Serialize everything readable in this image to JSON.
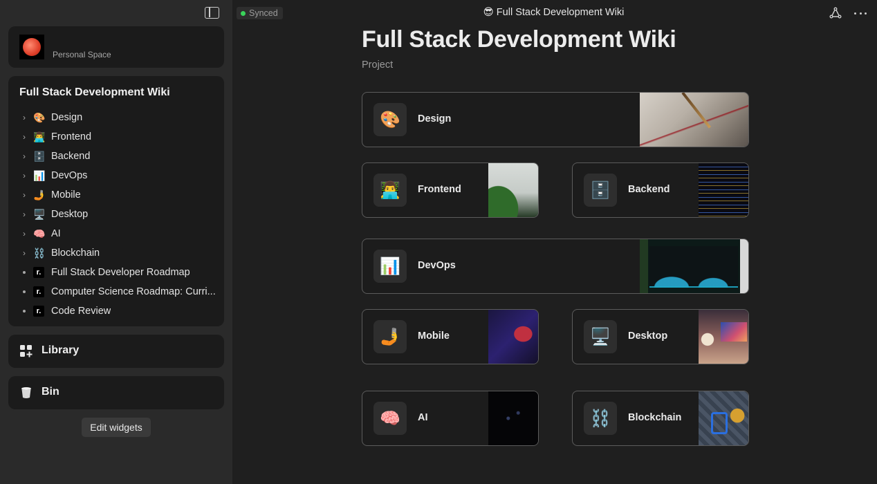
{
  "sidebar": {
    "space_label": "Personal Space",
    "wiki_title": "Full Stack Development Wiki",
    "tree": [
      {
        "kind": "folder",
        "icon": "🎨",
        "icon_name": "palette-icon",
        "label": "Design"
      },
      {
        "kind": "folder",
        "icon": "👨‍💻",
        "icon_name": "technologist-icon",
        "label": "Frontend"
      },
      {
        "kind": "folder",
        "icon": "🗄️",
        "icon_name": "file-cabinet-icon",
        "label": "Backend"
      },
      {
        "kind": "folder",
        "icon": "📊",
        "icon_name": "bar-chart-icon",
        "label": "DevOps"
      },
      {
        "kind": "folder",
        "icon": "🤳",
        "icon_name": "selfie-icon",
        "label": "Mobile"
      },
      {
        "kind": "folder",
        "icon": "🖥️",
        "icon_name": "desktop-computer-icon",
        "label": "Desktop"
      },
      {
        "kind": "folder",
        "icon": "🧠",
        "icon_name": "brain-icon",
        "label": "AI"
      },
      {
        "kind": "folder",
        "icon": "⛓️",
        "icon_name": "chains-icon",
        "label": "Blockchain"
      },
      {
        "kind": "doc",
        "icon": "r.",
        "icon_name": "roadmap-logo-icon",
        "label": "Full Stack Developer Roadmap"
      },
      {
        "kind": "doc",
        "icon": "r.",
        "icon_name": "roadmap-logo-icon",
        "label": "Computer Science Roadmap: Curri..."
      },
      {
        "kind": "doc",
        "icon": "r.",
        "icon_name": "roadmap-logo-icon",
        "label": "Code Review"
      }
    ],
    "library_label": "Library",
    "bin_label": "Bin",
    "edit_widgets_label": "Edit widgets"
  },
  "topbar": {
    "status": "Synced",
    "status_color": "#3ad35a",
    "title": "😎 Full Stack Development Wiki"
  },
  "main": {
    "title": "Full Stack Development Wiki",
    "subtitle": "Project",
    "tiles": [
      {
        "label": "Design",
        "icon": "🎨"
      },
      {
        "label": "Frontend",
        "icon": "👨‍💻"
      },
      {
        "label": "Backend",
        "icon": "🗄️"
      },
      {
        "label": "DevOps",
        "icon": "📊"
      },
      {
        "label": "Mobile",
        "icon": "🤳"
      },
      {
        "label": "Desktop",
        "icon": "🖥️"
      },
      {
        "label": "AI",
        "icon": "🧠"
      },
      {
        "label": "Blockchain",
        "icon": "⛓️"
      }
    ]
  }
}
